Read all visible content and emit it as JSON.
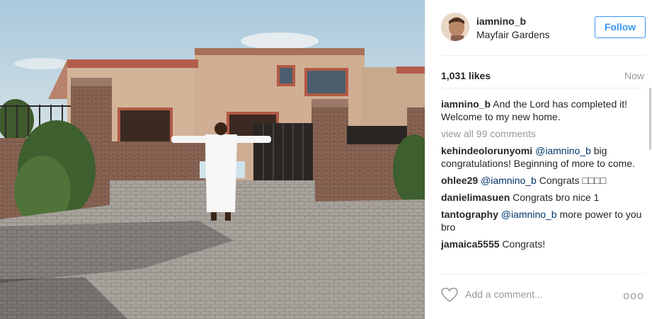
{
  "post": {
    "username": "iamnino_b",
    "location": "Mayfair Gardens",
    "follow_label": "Follow",
    "likes": "1,031 likes",
    "time": "Now",
    "view_all": "view all 99 comments",
    "add_comment_placeholder": "Add a comment...",
    "more_label": "ooo"
  },
  "comments": [
    {
      "user": "iamnino_b",
      "mention": "",
      "text": "And the Lord has completed it! Welcome to my new home."
    },
    {
      "user": "kehindeolorunyomi",
      "mention": "@iamnino_b",
      "text": " big congratulations! Beginning of more to come."
    },
    {
      "user": "ohlee29",
      "mention": "@iamnino_b",
      "text": " Congrats  □□□□"
    },
    {
      "user": "danielimasuen",
      "mention": "",
      "text": "Congrats bro nice 1"
    },
    {
      "user": "tantography",
      "mention": "@iamnino_b",
      "text": " more power to you bro"
    },
    {
      "user": "jamaica5555",
      "mention": "",
      "text": "Congrats!"
    }
  ],
  "colors": {
    "accent": "#3897f0",
    "mention": "#003569",
    "muted": "#999999",
    "text": "#262626"
  },
  "icons": {
    "heart": "heart-icon",
    "more": "more-options-icon"
  }
}
